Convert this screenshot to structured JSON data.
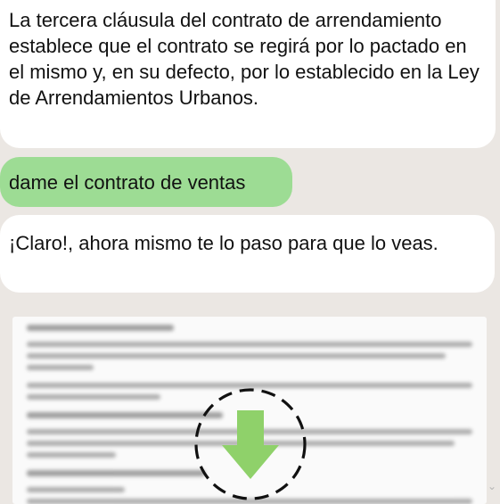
{
  "messages": [
    {
      "type": "incoming",
      "text": "La tercera cláusula del contrato de arrendamiento establece que el contrato se regirá por lo pactado en el mismo y, en su defecto, por lo establecido en la Ley de Arrendamientos Urbanos."
    },
    {
      "type": "outgoing",
      "text": "dame el contrato de ventas"
    },
    {
      "type": "incoming",
      "text": "¡Claro!, ahora mismo te lo paso para que lo veas."
    }
  ],
  "attachment": {
    "kind": "document-preview",
    "blurred": true,
    "icon": "download-icon"
  },
  "colors": {
    "background": "#ebe7e3",
    "incoming_bubble": "#ffffff",
    "outgoing_bubble": "#9ddc94",
    "download_arrow": "#8fd16a"
  }
}
